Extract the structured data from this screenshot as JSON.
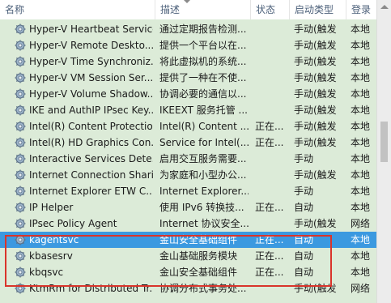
{
  "columns": {
    "name": "名称",
    "description": "描述",
    "status": "状态",
    "startup_type": "启动类型",
    "logon_as": "登录"
  },
  "rows": [
    {
      "name": "Hyper-V Heartbeat Service",
      "description": "通过定期报告检测...",
      "status": "",
      "startup_type": "手动(触发",
      "logon_as": "本地"
    },
    {
      "name": "Hyper-V Remote Deskto...",
      "description": "提供一个平台以在...",
      "status": "",
      "startup_type": "手动(触发",
      "logon_as": "本地"
    },
    {
      "name": "Hyper-V Time Synchroniz...",
      "description": "将此虚拟机的系统...",
      "status": "",
      "startup_type": "手动(触发",
      "logon_as": "本地"
    },
    {
      "name": "Hyper-V VM Session Ser...",
      "description": "提供了一种在不使...",
      "status": "",
      "startup_type": "手动(触发",
      "logon_as": "本地"
    },
    {
      "name": "Hyper-V Volume Shadow...",
      "description": "协调必要的通信以...",
      "status": "",
      "startup_type": "手动(触发",
      "logon_as": "本地"
    },
    {
      "name": "IKE and AuthIP IPsec Key...",
      "description": "IKEEXT 服务托管 ...",
      "status": "",
      "startup_type": "手动(触发",
      "logon_as": "本地"
    },
    {
      "name": "Intel(R) Content Protectio...",
      "description": "Intel(R) Content ...",
      "status": "正在...",
      "startup_type": "手动(触发",
      "logon_as": "本地"
    },
    {
      "name": "Intel(R) HD Graphics Con...",
      "description": "Service for Intel(...",
      "status": "正在...",
      "startup_type": "手动(触发",
      "logon_as": "本地"
    },
    {
      "name": "Interactive Services Dete...",
      "description": "启用交互服务需要...",
      "status": "",
      "startup_type": "手动",
      "logon_as": "本地"
    },
    {
      "name": "Internet Connection Shari...",
      "description": "为家庭和小型办公...",
      "status": "",
      "startup_type": "手动(触发",
      "logon_as": "本地"
    },
    {
      "name": "Internet Explorer ETW C...",
      "description": "Internet Explorer...",
      "status": "",
      "startup_type": "手动",
      "logon_as": "本地"
    },
    {
      "name": "IP Helper",
      "description": "使用 IPv6 转换技...",
      "status": "正在...",
      "startup_type": "自动",
      "logon_as": "本地"
    },
    {
      "name": "IPsec Policy Agent",
      "description": "Internet 协议安全...",
      "status": "",
      "startup_type": "手动(触发",
      "logon_as": "网络"
    },
    {
      "name": "kagentsvc",
      "description": "金山安全基础组件",
      "status": "正在...",
      "startup_type": "自动",
      "logon_as": "本地",
      "selected": true
    },
    {
      "name": "kbasesrv",
      "description": "金山基础服务模块",
      "status": "正在...",
      "startup_type": "自动",
      "logon_as": "本地"
    },
    {
      "name": "kbqsvc",
      "description": "金山安全基础组件",
      "status": "正在...",
      "startup_type": "自动",
      "logon_as": "本地"
    },
    {
      "name": "KtmRm for Distributed Tr...",
      "description": "协调分布式事务处...",
      "status": "",
      "startup_type": "手动(触发",
      "logon_as": "网络"
    }
  ],
  "icons": {
    "service": "gear-icon"
  },
  "colors": {
    "selected_bg": "#3b99e0",
    "highlight_border": "#d9342b",
    "list_bg": "#dcebd8"
  }
}
